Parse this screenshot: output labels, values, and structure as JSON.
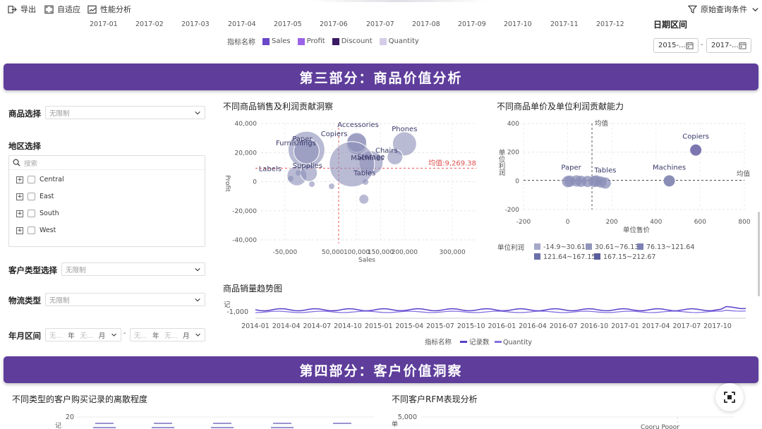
{
  "toolbar": {
    "export_label": "导出",
    "adaptive_label": "自适应",
    "perf_label": "性能分析",
    "query_label": "原始查询条件"
  },
  "months": [
    "2017-01",
    "2017-02",
    "2017-03",
    "2017-04",
    "2017-05",
    "2017-06",
    "2017-07",
    "2017-08",
    "2017-09",
    "2017-10",
    "2017-11",
    "2017-12"
  ],
  "top_legend": {
    "title": "指标名称",
    "items": [
      {
        "label": "Sales",
        "color": "#6a48c9"
      },
      {
        "label": "Profit",
        "color": "#9a63e8"
      },
      {
        "label": "Discount",
        "color": "#3a1a63"
      },
      {
        "label": "Quantity",
        "color": "#d5cde8"
      }
    ]
  },
  "date_range": {
    "title": "日期区间",
    "start": "2015-...",
    "sep": "-",
    "end": "2017-..."
  },
  "section3_title": "第三部分：商品价值分析",
  "section4_title": "第四部分：客户价值洞察",
  "filters": {
    "product_label": "商品选择",
    "product_value": "无限制",
    "region_label": "地区选择",
    "search_placeholder": "搜索",
    "regions": [
      "Central",
      "East",
      "South",
      "West"
    ],
    "customer_type_label": "客户类型选择",
    "customer_type_value": "无限制",
    "logistics_label": "物流类型",
    "logistics_value": "无限制",
    "ym_label": "年月区间",
    "ym_none1": "无...",
    "ym_none2": "无...",
    "ym_year": "年",
    "ym_month": "月",
    "ym_none3": "无...",
    "ym_none4": "无...",
    "ym_sep": "-"
  },
  "chart_bubble": {
    "title": "不同商品销售及利润贡献洞察",
    "xlabel": "Sales",
    "ylabel": "Profit",
    "mean_label": "均值:9,269.38",
    "xticks": [
      "-50,000",
      "50,000",
      "100,000",
      "150,000",
      "200,000",
      "300,000"
    ],
    "yticks": [
      "40,000",
      "20,000",
      "0",
      "-20,000",
      "-40,000"
    ],
    "label_lines": "Paper",
    "labels": [
      "Paper",
      "Accessories",
      "Copiers",
      "Phones",
      "Chairs",
      "Furnishings",
      "Storage",
      "Labels",
      "Supplies",
      "Machines",
      "Tables"
    ]
  },
  "chart_data": [
    {
      "type": "scatter",
      "title": "不同商品销售及利润贡献洞察",
      "xlabel": "Sales",
      "ylabel": "Profit",
      "xlim": [
        -100000,
        350000
      ],
      "ylim": [
        -40000,
        40000
      ],
      "mean_profit": 9269.38,
      "points": [
        {
          "name": "Paper",
          "x": -5000,
          "y": 22000
        },
        {
          "name": "Furnishings",
          "x": -5000,
          "y": 21000
        },
        {
          "name": "Copiers",
          "x": 100000,
          "y": 26000
        },
        {
          "name": "Accessories",
          "x": 100000,
          "y": 27000
        },
        {
          "name": "Phones",
          "x": 200000,
          "y": 26000
        },
        {
          "name": "Chairs",
          "x": 180000,
          "y": 17000
        },
        {
          "name": "Storage",
          "x": 130000,
          "y": 13000
        },
        {
          "name": "Machines",
          "x": 90000,
          "y": 12000
        },
        {
          "name": "Labels",
          "x": -25000,
          "y": 4000
        },
        {
          "name": "Supplies",
          "x": 0,
          "y": 6000
        },
        {
          "name": "Tables",
          "x": 115000,
          "y": -12000
        }
      ]
    },
    {
      "type": "scatter",
      "title": "不同商品单价及单位利润贡献能力",
      "xlabel": "单位售价",
      "ylabel": "单位利润",
      "xlim": [
        -200,
        800
      ],
      "ylim": [
        -200,
        400
      ],
      "mean_label": "均值",
      "points": [
        {
          "name": "Copiers",
          "x": 580,
          "y": 215
        },
        {
          "name": "Paper",
          "x": 0,
          "y": 0
        },
        {
          "name": "Tables",
          "x": 170,
          "y": -15
        },
        {
          "name": "Machines",
          "x": 460,
          "y": 0
        }
      ],
      "legend_title": "单位利润",
      "legend": [
        "-14.9~30.61",
        "30.61~76.13",
        "76.13~121.64",
        "121.64~167.15",
        "167.15~212.67"
      ]
    },
    {
      "type": "line",
      "title": "商品销量趋势图",
      "x": [
        "2014-01",
        "2014-04",
        "2014-07",
        "2014-10",
        "2015-01",
        "2015-04",
        "2015-07",
        "2015-10",
        "2016-01",
        "2016-04",
        "2016-07",
        "2016-10",
        "2017-01",
        "2017-04",
        "2017-07",
        "2017-10"
      ],
      "series": [
        {
          "name": "记录数"
        },
        {
          "name": "Quantity"
        }
      ],
      "ylabel": "记",
      "ytick": "-1,000"
    }
  ],
  "chart_scatter": {
    "title": "不同商品单价及单位利润贡献能力",
    "xlabel": "单位售价",
    "ylabel": "单位利润",
    "mean_label": "均值",
    "mean_label2": "均值",
    "xticks": [
      "-200",
      "0",
      "200",
      "400",
      "600",
      "800"
    ],
    "yticks": [
      "400",
      "200",
      "0",
      "-200"
    ],
    "labels": [
      "Copiers",
      "Paper",
      "Tables",
      "Machines"
    ],
    "legend_title": "单位利润",
    "legend": [
      "-14.9~30.61",
      "30.61~76.13",
      "76.13~121.64",
      "121.64~167.15",
      "167.15~212.67"
    ]
  },
  "chart_trend": {
    "title": "商品销量趋势图",
    "ylabel": "记",
    "ytick": "-1,000",
    "xticks": [
      "2014-01",
      "2014-04",
      "2014-07",
      "2014-10",
      "2015-01",
      "2015-04",
      "2015-07",
      "2015-10",
      "2016-01",
      "2016-04",
      "2016-07",
      "2016-10",
      "2017-01",
      "2017-04",
      "2017-07",
      "2017-10"
    ],
    "legend_title": "指标名称",
    "legend": [
      "记录数",
      "Quantity"
    ]
  },
  "section4": {
    "left_title": "不同类型的客户购买记录的离散程度",
    "left_ytick": "20",
    "left_ylabel": "记",
    "right_title": "不同客户RFM表现分析",
    "right_ytick": "5,000",
    "right_ylabel": "单",
    "right_partial": "Cooru Pooor"
  }
}
